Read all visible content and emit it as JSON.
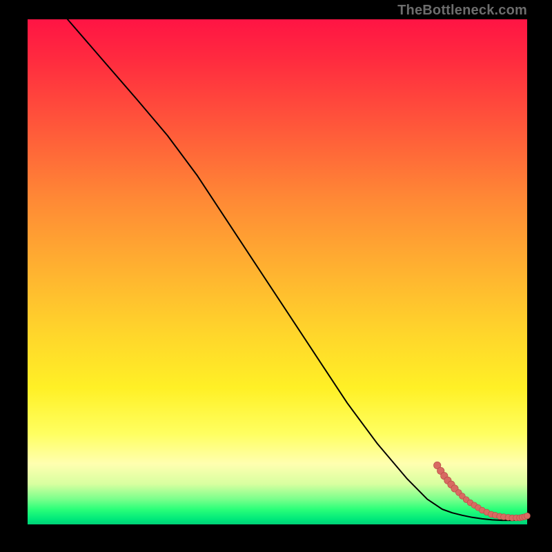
{
  "attribution": "TheBottleneck.com",
  "colors": {
    "page_bg": "#000000",
    "gradient_top": "#ff1444",
    "gradient_mid": "#ffd52b",
    "gradient_bottom": "#00d078",
    "line": "#000000",
    "dot_fill": "#d86a62",
    "dot_stroke": "#b84d46",
    "attribution_text": "#6d6d6d"
  },
  "chart_data": {
    "type": "line",
    "title": "",
    "xlabel": "",
    "ylabel": "",
    "xlim": [
      0,
      100
    ],
    "ylim": [
      0,
      100
    ],
    "grid": false,
    "legend": false,
    "series": [
      {
        "name": "curve",
        "kind": "line",
        "x": [
          8,
          15,
          22,
          28,
          34,
          40,
          46,
          52,
          58,
          64,
          70,
          76,
          80,
          83,
          85,
          87,
          89,
          91,
          93,
          95,
          97,
          99,
          100
        ],
        "y": [
          100,
          92,
          84,
          77,
          69,
          60,
          51,
          42,
          33,
          24,
          16,
          9,
          5,
          3,
          2.3,
          1.8,
          1.4,
          1.1,
          0.9,
          0.8,
          0.8,
          0.9,
          1.4
        ]
      },
      {
        "name": "dots",
        "kind": "scatter",
        "x": [
          82.0,
          82.7,
          83.4,
          84.1,
          84.8,
          85.5,
          86.3,
          87.0,
          87.8,
          88.6,
          89.4,
          90.2,
          91.0,
          91.9,
          92.8,
          93.6,
          94.5,
          95.3,
          96.2,
          97.0,
          97.8,
          98.5,
          99.0,
          99.5,
          100.0
        ],
        "y": [
          11.7,
          10.6,
          9.6,
          8.7,
          7.9,
          7.1,
          6.3,
          5.6,
          4.9,
          4.3,
          3.8,
          3.3,
          2.8,
          2.4,
          2.0,
          1.8,
          1.6,
          1.5,
          1.4,
          1.3,
          1.3,
          1.3,
          1.4,
          1.5,
          1.7
        ]
      }
    ]
  }
}
